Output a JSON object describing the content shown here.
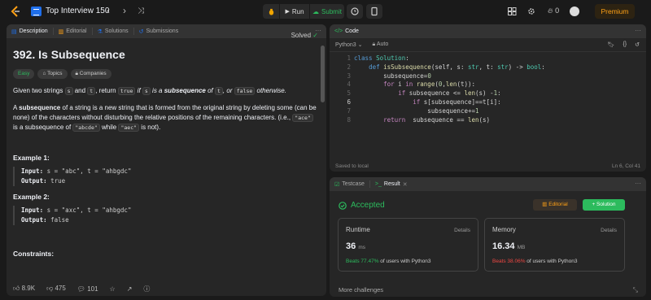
{
  "topbar": {
    "problem_list_title": "Top Interview 150",
    "prev": "‹",
    "next": "›",
    "shuffle": "⤨",
    "run_label": "Run",
    "submit_label": "Submit",
    "streak_count": "0",
    "premium_label": "Premium"
  },
  "left_tabs": [
    "Description",
    "Editorial",
    "Solutions",
    "Submissions"
  ],
  "problem": {
    "title": "392. Is Subsequence",
    "status": "Solved",
    "difficulty": "Easy",
    "topics_label": "Topics",
    "companies_label": "Companies",
    "desc_1": {
      "a": "Given two strings ",
      "s": "s",
      "b": " and ",
      "t": "t",
      "c": ", return ",
      "true": "true",
      "d": " if ",
      "s2": "s",
      "e": " is a ",
      "f": "subsequence",
      "g": " of ",
      "t2": "t",
      "h": ", or ",
      "false": "false",
      "i": " otherwise."
    },
    "desc_2": {
      "a": "A ",
      "b": "subsequence",
      "c": " of a string is a new string that is formed from the original string by deleting some (can be none) of the characters without disturbing the relative positions of the remaining characters. (i.e., ",
      "ace": "\"ace\"",
      "d": " is a subsequence of ",
      "abcde": "\"abcde\"",
      "e": " while ",
      "aec": "\"aec\"",
      "f": " is not)."
    },
    "examples": [
      {
        "title": "Example 1:",
        "input_label": "Input:",
        "input": "s = \"abc\", t = \"ahbgdc\"",
        "output_label": "Output:",
        "output": "true"
      },
      {
        "title": "Example 2:",
        "input_label": "Input:",
        "input": "s = \"axc\", t = \"ahbgdc\"",
        "output_label": "Output:",
        "output": "false"
      }
    ],
    "constraints_title": "Constraints:"
  },
  "footer": {
    "likes": "8.9K",
    "dislikes": "475",
    "comments": "101"
  },
  "code_panel": {
    "tab_label": "Code",
    "language": "Python3",
    "autocomplete": "Auto",
    "line_numbers": [
      "1",
      "2",
      "3",
      "4",
      "5",
      "6",
      "7",
      "8"
    ],
    "saved": "Saved to local",
    "cursor": "Ln 6, Col 41"
  },
  "result_panel": {
    "testcase_label": "Testcase",
    "result_label": "Result",
    "status": "Accepted",
    "editorial_label": "Editorial",
    "solution_label": "Solution",
    "runtime": {
      "title": "Runtime",
      "details": "Details",
      "value": "36",
      "unit": "ms",
      "beats": "Beats 77.47%",
      "beats_suffix": "of users with Python3"
    },
    "memory": {
      "title": "Memory",
      "details": "Details",
      "value": "16.34",
      "unit": "MB",
      "beats": "Beats 38.06%",
      "beats_suffix": "of users with Python3"
    },
    "more": "More challenges"
  },
  "colors": {
    "accent": "#ffa116",
    "success": "#2cbb5d",
    "error": "#ef4743"
  }
}
